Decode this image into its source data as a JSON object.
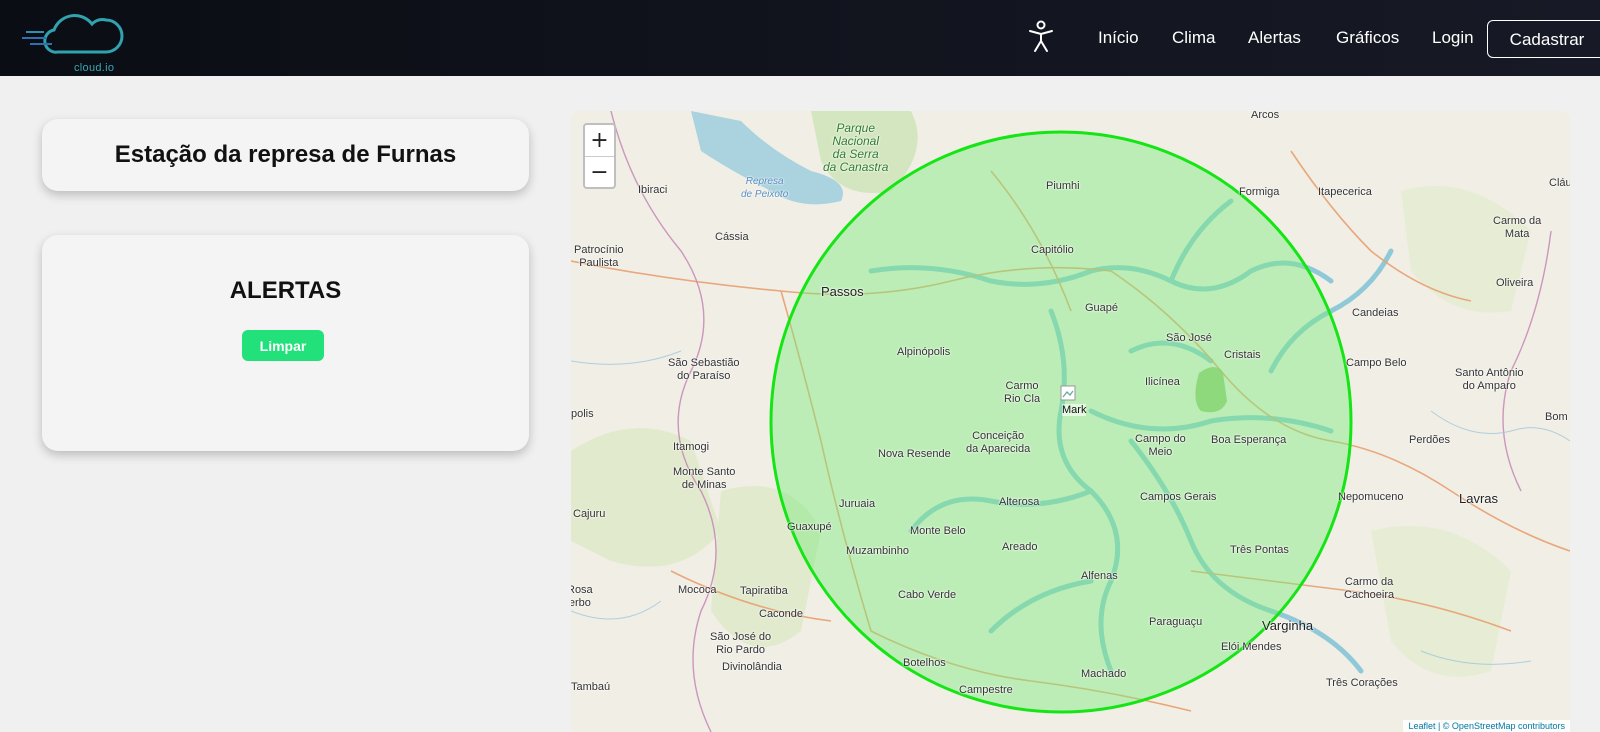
{
  "brand": {
    "logo_text": "cloud.io"
  },
  "nav": {
    "accessibility_icon": "accessibility-icon",
    "links": [
      "Início",
      "Clima",
      "Alertas",
      "Gráficos",
      "Login"
    ],
    "signup_label": "Cadastrar"
  },
  "station": {
    "title": "Estação da represa de Furnas"
  },
  "alerts": {
    "title": "ALERTAS",
    "clear_label": "Limpar"
  },
  "map": {
    "zoom_in": "+",
    "zoom_out": "−",
    "marker_alt": "Mark",
    "circle_color": "#15e515",
    "circle_fill": "#7cec7c",
    "attribution": "Leaflet | © OpenStreetMap contributors",
    "places": {
      "arcos": "Arcos",
      "parque": "Parque\nNacional\nda Serra\nda Canastra",
      "piumhi": "Piumhi",
      "formiga": "Formiga",
      "itapecerica": "Itapecerica",
      "claudio": "Cláu",
      "ibiraci": "Ibiraci",
      "represa": "Represa\nde Peixoto",
      "cassia": "Cássia",
      "capitolio": "Capitólio",
      "carmo_mata": "Carmo da\nMata",
      "oliveira": "Oliveira",
      "patrocinio": "Patrocínio\nPaulista",
      "passos": "Passos",
      "guape": "Guapé",
      "candeias": "Candeias",
      "sao_jose": "São José",
      "cristais": "Cristais",
      "campo_belo": "Campo Belo",
      "alpinopolis": "Alpinópolis",
      "sao_sebastiao": "São Sebastião\ndo Paraíso",
      "carmo_rio": "Carmo\nRio Cla",
      "ilicinea": "Ilicínea",
      "santo_antonio": "Santo Antônio\ndo Amparo",
      "polis": "polis",
      "bom_s": "Bom S",
      "itamogi": "Itamogi",
      "conceicao": "Conceição\nda Aparecida",
      "campo_meio": "Campo do\nMeio",
      "boa_esperanca": "Boa Esperança",
      "perdoes": "Perdões",
      "nova_resende": "Nova Resende",
      "monte_santo": "Monte Santo\nde Minas",
      "juruaia": "Juruaia",
      "alterosa": "Alterosa",
      "campos_gerais": "Campos Gerais",
      "nepomuceno": "Nepomuceno",
      "lavras": "Lavras",
      "cajuru": "Cajuru",
      "guaxupe": "Guaxupé",
      "monte_belo": "Monte Belo",
      "areado": "Areado",
      "muzambinho": "Muzambinho",
      "tres_pontas": "Três Pontas",
      "alfenas": "Alfenas",
      "mococa": "Mococa",
      "tapiratiba": "Tapiratiba",
      "cabo_verde": "Cabo Verde",
      "carmo_cachoeira": "Carmo da\nCachoeira",
      "rosa": "Rosa\nerbo",
      "caconde": "Caconde",
      "paraguacu": "Paraguaçu",
      "varginha": "Varginha",
      "sao_jose_rio": "São José do\nRio Pardo",
      "eloi": "Elói Mendes",
      "divinolandia": "Divinolândia",
      "botelhos": "Botelhos",
      "machado": "Machado",
      "tambau": "Tambaú",
      "campestre": "Campestre",
      "tres_coracoes": "Três Corações"
    }
  }
}
